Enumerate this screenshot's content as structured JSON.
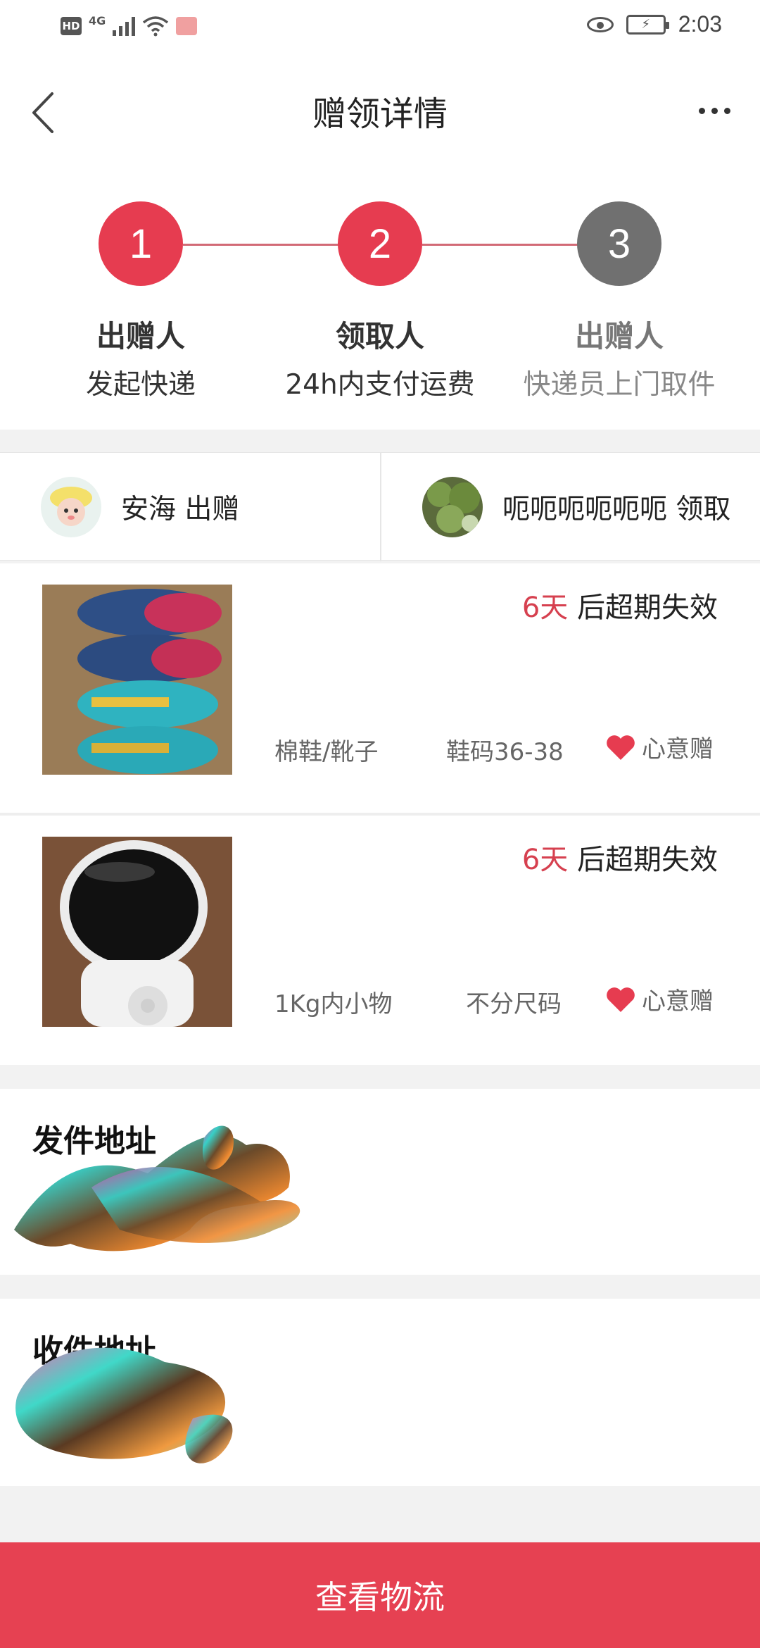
{
  "status_bar": {
    "hd": "HD",
    "network": "4G",
    "time": "2:03",
    "icons": [
      "signal-icon",
      "wifi-icon",
      "app-notification-icon",
      "eye-icon",
      "battery-charging-icon"
    ]
  },
  "header": {
    "title": "赠领详情",
    "back_icon": "back-chevron-icon",
    "more_icon": "more-dots-icon"
  },
  "steps": [
    {
      "number": "1",
      "role": "出赠人",
      "desc": "发起快递",
      "state": "active"
    },
    {
      "number": "2",
      "role": "领取人",
      "desc": "24h内支付运费",
      "state": "active"
    },
    {
      "number": "3",
      "role": "出赠人",
      "desc": "快递员上门取件",
      "state": "inactive"
    }
  ],
  "people": {
    "giver": {
      "name": "安海",
      "action": "出赠",
      "display": "安海 出赠"
    },
    "receiver": {
      "name": "呃呃呃呃呃呃",
      "action": "领取",
      "display": "呃呃呃呃呃呃 领取"
    }
  },
  "items": [
    {
      "expire_days": "6天",
      "expire_text": " 后超期失效",
      "category": "棉鞋/靴子",
      "size": "鞋码36-38",
      "tag": "心意赠",
      "image": "shoes-photo"
    },
    {
      "expire_days": "6天",
      "expire_text": " 后超期失效",
      "category": "1Kg内小物",
      "size": "不分尺码",
      "tag": "心意赠",
      "image": "robot-toy-photo"
    }
  ],
  "addresses": {
    "send_title": "发件地址",
    "receive_title": "收件地址"
  },
  "bottom_button": {
    "label": "查看物流"
  },
  "colors": {
    "accent": "#e63c50",
    "inactive": "#707070",
    "button": "#e64152"
  }
}
